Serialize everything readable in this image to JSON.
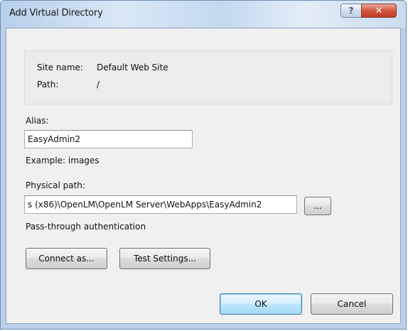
{
  "window": {
    "title": "Add Virtual Directory",
    "help_glyph": "?",
    "close_glyph": "✕"
  },
  "info": {
    "site_name_label": "Site name:",
    "site_name_value": "Default Web Site",
    "path_label": "Path:",
    "path_value": "/"
  },
  "alias": {
    "label": "Alias:",
    "value": "EasyAdmin2",
    "example": "Example: images"
  },
  "physical_path": {
    "label": "Physical path:",
    "value": "s (x86)\\OpenLM\\OpenLM Server\\WebApps\\EasyAdmin2",
    "browse_label": "..."
  },
  "auth": {
    "label": "Pass-through authentication",
    "connect_as_label": "Connect as...",
    "test_settings_label": "Test Settings..."
  },
  "footer": {
    "ok_label": "OK",
    "cancel_label": "Cancel"
  }
}
